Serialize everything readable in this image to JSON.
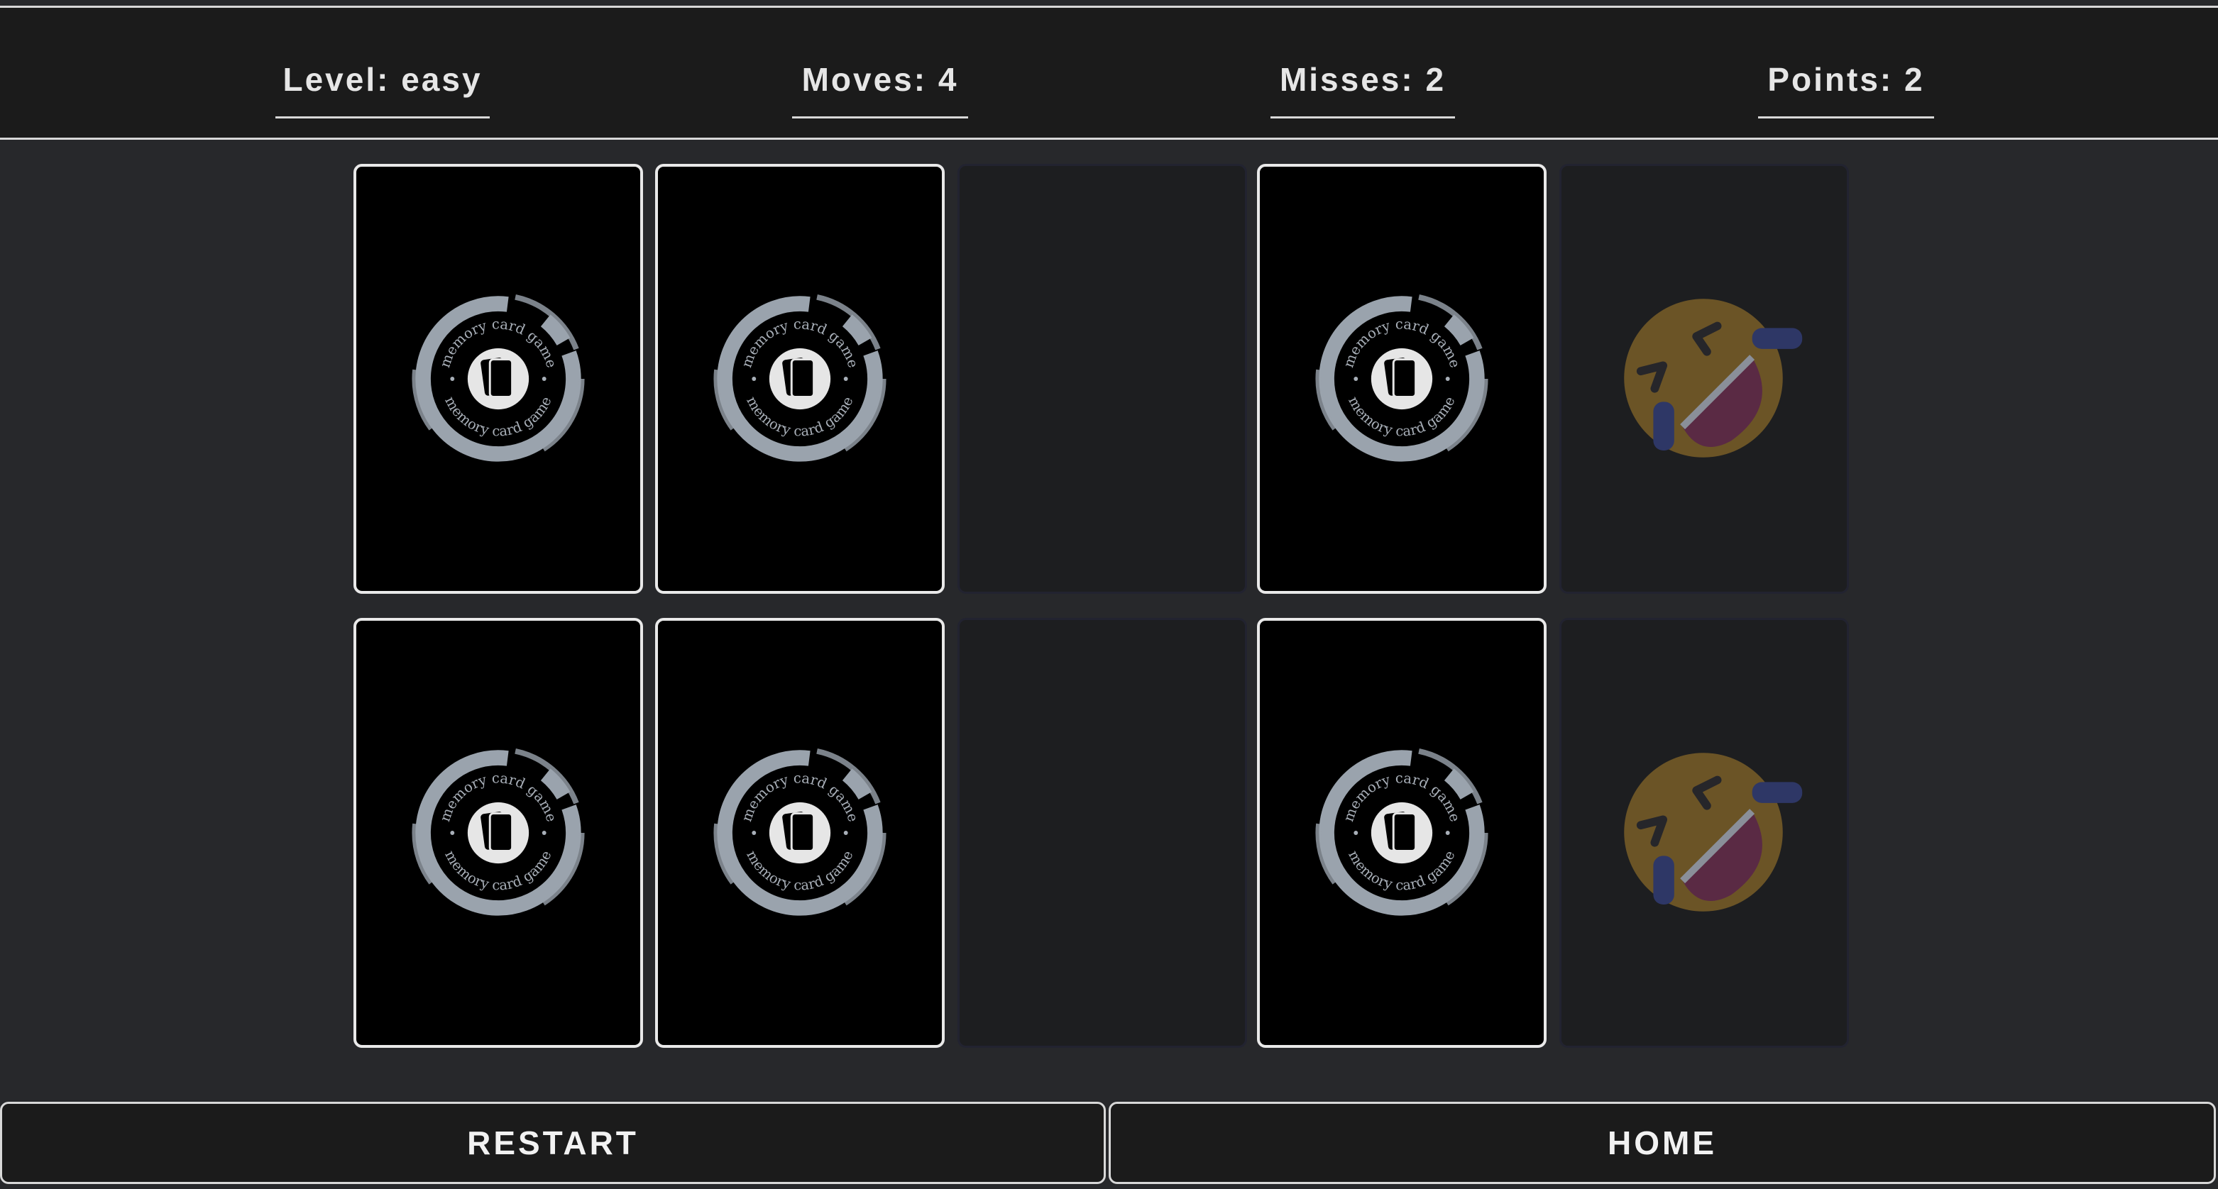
{
  "header": {
    "level": "Level: easy",
    "moves": "Moves: 4",
    "misses": "Misses: 2",
    "points": "Points: 2"
  },
  "board": {
    "card_back_text": "memory card game",
    "rows": [
      [
        {
          "state": "face-down"
        },
        {
          "state": "face-down"
        },
        {
          "state": "removed"
        },
        {
          "state": "face-down"
        },
        {
          "state": "matched",
          "icon": "rolling-on-floor-laughing-emoji-icon"
        }
      ],
      [
        {
          "state": "face-down"
        },
        {
          "state": "face-down"
        },
        {
          "state": "removed"
        },
        {
          "state": "face-down"
        },
        {
          "state": "matched",
          "icon": "rolling-on-floor-laughing-emoji-icon"
        }
      ]
    ]
  },
  "footer": {
    "restart_label": "RESTART",
    "home_label": "HOME"
  },
  "colors": {
    "background": "#27282b",
    "header_bg": "#1b1b1b",
    "card_back": "#000000",
    "card_border": "#e9e9e9",
    "logo_ring": "#9aa3ad",
    "emoji_face": "#6b5426",
    "emoji_mouth": "#5a2a44",
    "emoji_tears": "#2e3766"
  }
}
